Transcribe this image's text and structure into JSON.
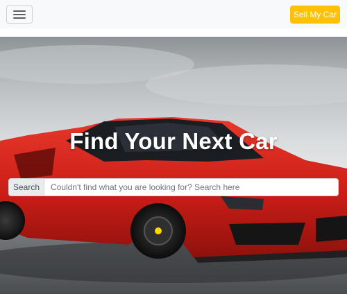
{
  "navbar": {
    "menu_icon": "hamburger-menu-icon",
    "sell_button_label": "Sell My Car",
    "sell_button_color": "#ffc107"
  },
  "hero": {
    "image": "red-sports-car-photo",
    "title": "Find Your Next Car",
    "search": {
      "label": "Search",
      "placeholder": "Couldn't find what you are looking for? Search here",
      "value": ""
    }
  },
  "colors": {
    "navbar_bg": "#f8f9fa",
    "car_red": "#d9261c",
    "accent": "#ffc107"
  }
}
